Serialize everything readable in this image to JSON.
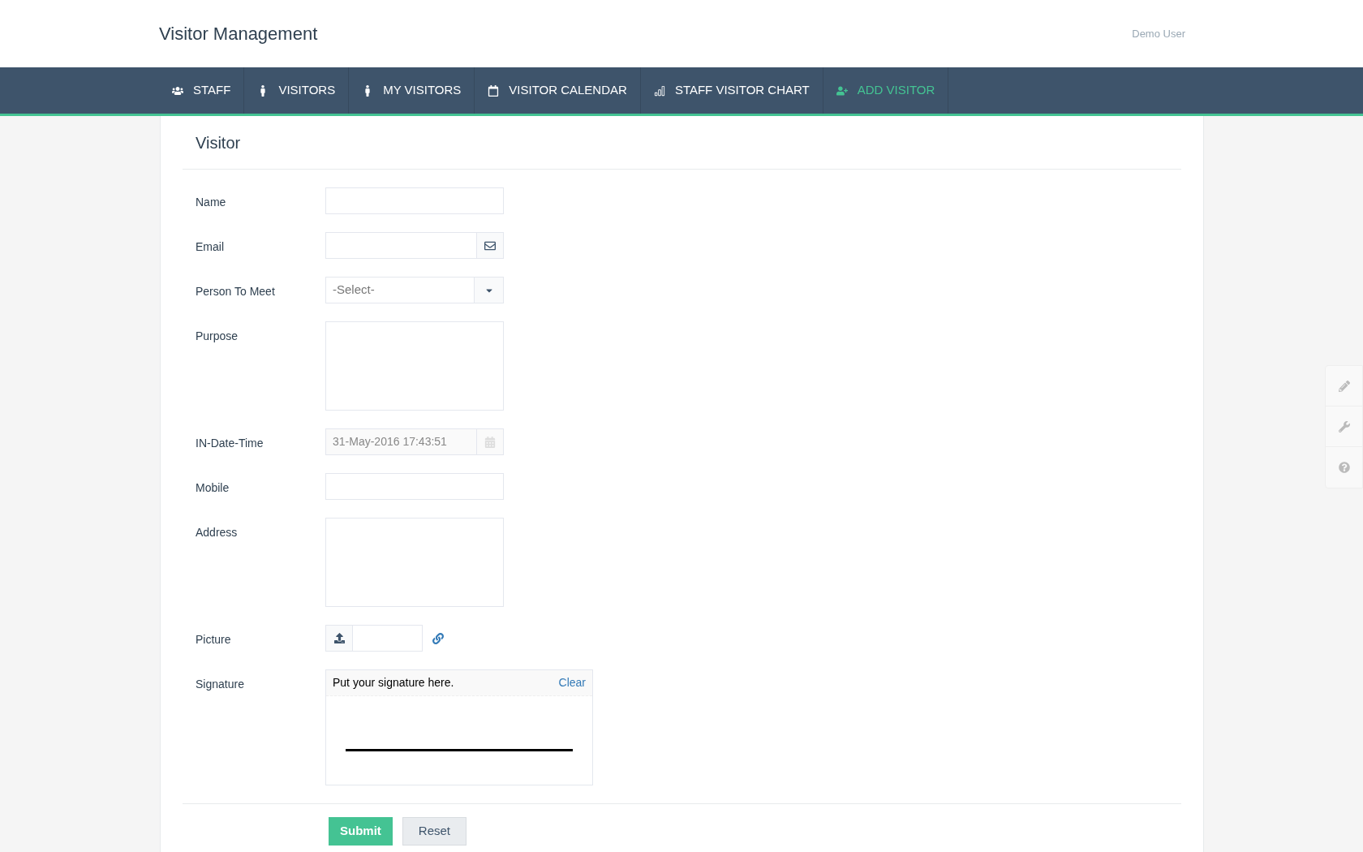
{
  "header": {
    "title": "Visitor Management",
    "user": "Demo User"
  },
  "nav": [
    {
      "label": "STAFF",
      "kind": "users",
      "selected": false
    },
    {
      "label": "VISITORS",
      "kind": "person",
      "selected": false
    },
    {
      "label": "MY VISITORS",
      "kind": "person",
      "selected": false
    },
    {
      "label": "VISITOR CALENDAR",
      "kind": "calendar",
      "selected": false
    },
    {
      "label": "STAFF VISITOR CHART",
      "kind": "chart",
      "selected": false
    },
    {
      "label": "ADD VISITOR",
      "kind": "adduser",
      "selected": true
    }
  ],
  "form": {
    "title": "Visitor",
    "fields": [
      {
        "label": "Name",
        "kind": "text"
      },
      {
        "label": "Email",
        "kind": "email"
      },
      {
        "label": "Person To Meet",
        "kind": "select",
        "value": "-Select-"
      },
      {
        "label": "Purpose",
        "kind": "textarea"
      },
      {
        "label": "IN-Date-Time",
        "kind": "date",
        "value": "31-May-2016 17:43:51"
      },
      {
        "label": "Mobile",
        "kind": "text"
      },
      {
        "label": "Address",
        "kind": "textarea"
      },
      {
        "label": "Picture",
        "kind": "file"
      },
      {
        "label": "Signature",
        "kind": "signature",
        "prompt": "Put your signature here.",
        "clear": "Clear"
      }
    ],
    "buttons": [
      {
        "label": "Submit",
        "kind": "primary"
      },
      {
        "label": "Reset",
        "kind": "secondary"
      }
    ]
  }
}
